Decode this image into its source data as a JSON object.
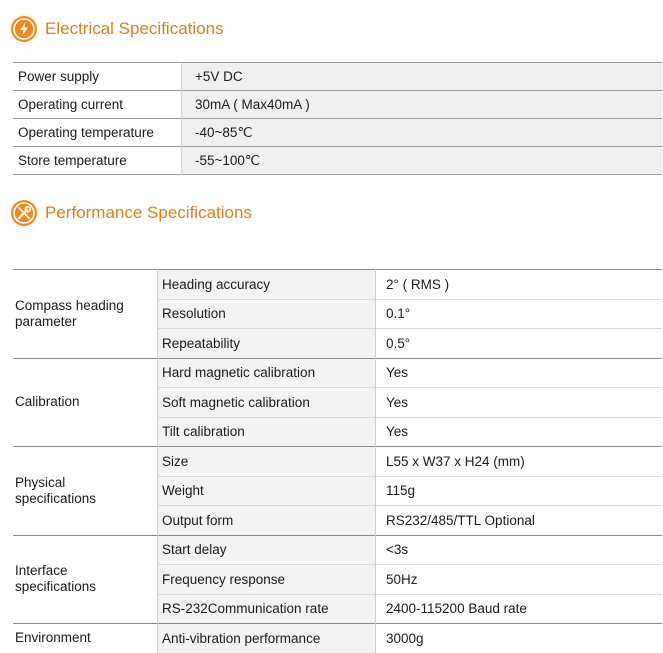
{
  "electrical": {
    "title": "Electrical Specifications",
    "icon": "lightning-icon",
    "rows": [
      {
        "label": "Power supply",
        "value": "+5V DC"
      },
      {
        "label": "Operating  current",
        "value": "30mA ( Max40mA )"
      },
      {
        "label": "Operating  temperature",
        "value": "-40~85℃"
      },
      {
        "label": "Store temperature",
        "value": "-55~100℃"
      }
    ]
  },
  "performance": {
    "title": "Performance Specifications",
    "icon": "tools-icon",
    "groups": [
      {
        "name": "Compass heading\nparameter",
        "rows": [
          {
            "label": "Heading accuracy",
            "value": "2° ( RMS )"
          },
          {
            "label": "Resolution",
            "value": "0.1°"
          },
          {
            "label": "Repeatability",
            "value": "0.5°"
          }
        ]
      },
      {
        "name": "Calibration",
        "rows": [
          {
            "label": "Hard magnetic calibration",
            "value": "Yes"
          },
          {
            "label": "Soft magnetic calibration",
            "value": "Yes"
          },
          {
            "label": "Tilt calibration",
            "value": "Yes"
          }
        ]
      },
      {
        "name": "Physical\nspecifications",
        "rows": [
          {
            "label": "Size",
            "value": "L55 x W37 x H24  (mm)"
          },
          {
            "label": "Weight",
            "value": "115g"
          },
          {
            "label": "Output form",
            "value": "RS232/485/TTL Optional"
          }
        ]
      },
      {
        "name": "Interface\nspecifications",
        "rows": [
          {
            "label": "Start delay",
            "value": "<3s"
          },
          {
            "label": "Frequency response",
            "value": "50Hz"
          },
          {
            "label": "RS-232Communication rate",
            "value": "2400-115200 Baud rate"
          }
        ]
      },
      {
        "name": "Environment",
        "rows": [
          {
            "label": "Anti-vibration performance",
            "value": "3000g"
          }
        ]
      }
    ]
  },
  "colors": {
    "accent": "#e07d14"
  }
}
